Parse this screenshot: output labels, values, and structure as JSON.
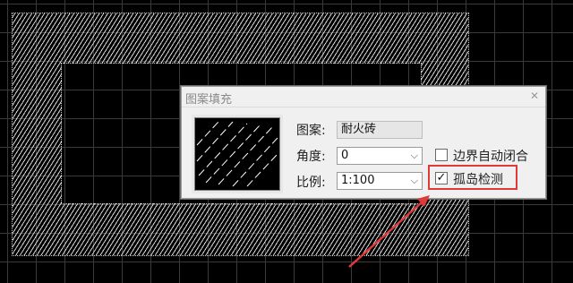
{
  "dialog": {
    "title": "图案填充",
    "close_icon": "close-icon"
  },
  "fields": {
    "pattern_label": "图案:",
    "pattern_value": "耐火砖",
    "angle_label": "角度:",
    "angle_value": "0",
    "scale_label": "比例:",
    "scale_value": "1:100"
  },
  "options": {
    "boundary_auto_close_label": "边界自动闭合",
    "boundary_auto_close_checked": false,
    "island_detection_label": "孤岛检测",
    "island_detection_checked": true
  },
  "annotation": {
    "color": "#e03a3a"
  },
  "colors": {
    "canvas_bg": "#000000",
    "hatch": "#d8d8d8",
    "dialog_bg": "#f0f0f0"
  }
}
